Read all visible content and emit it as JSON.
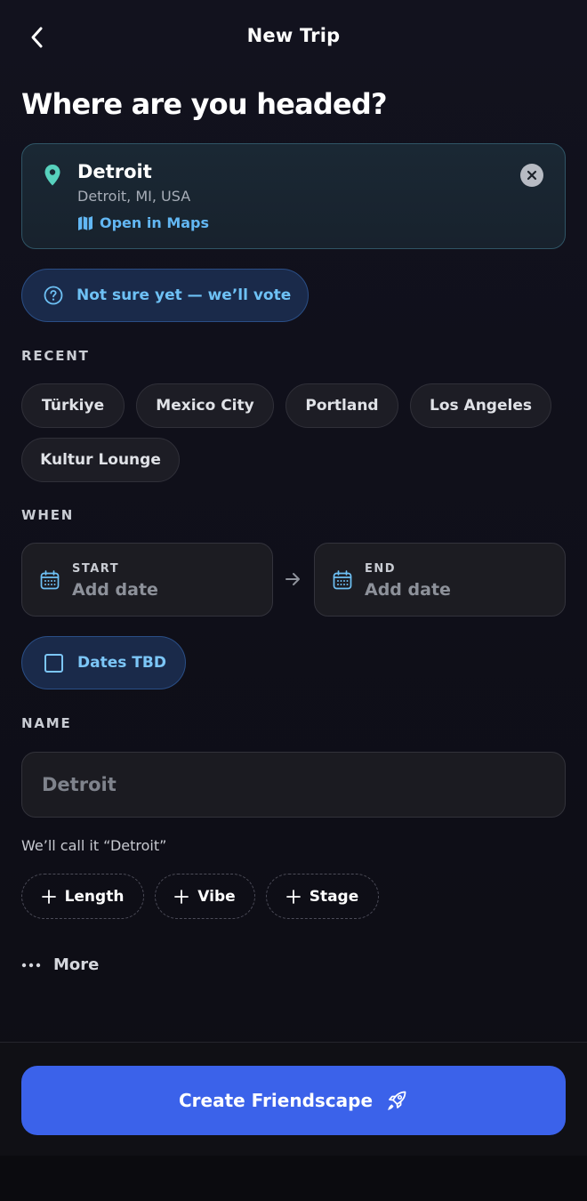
{
  "nav": {
    "title": "New Trip",
    "back_icon": "chevron-left-icon"
  },
  "heading": "Where are you headed?",
  "destination": {
    "name": "Detroit",
    "location": "Detroit, MI, USA",
    "maps_link": "Open in Maps",
    "pin_icon": "map-pin-icon",
    "clear_icon": "close-icon"
  },
  "vote_option": {
    "label": "Not sure yet — we’ll vote",
    "icon": "question-circle-icon"
  },
  "recent": {
    "label": "RECENT",
    "items": [
      "Türkiye",
      "Mexico City",
      "Portland",
      "Los Angeles",
      "Kultur Lounge"
    ]
  },
  "when": {
    "label": "WHEN",
    "start": {
      "label": "START",
      "value": "Add date"
    },
    "end": {
      "label": "END",
      "value": "Add date"
    },
    "tbd": {
      "label": "Dates TBD",
      "checked": false
    }
  },
  "name": {
    "label": "NAME",
    "placeholder": "Detroit",
    "hint": "We’ll call it “Detroit”"
  },
  "tags": [
    {
      "label": "Length"
    },
    {
      "label": "Vibe"
    },
    {
      "label": "Stage"
    }
  ],
  "more": {
    "label": "More"
  },
  "cta": {
    "label": "Create Friendscape",
    "icon": "rocket-icon"
  },
  "colors": {
    "accent": "#3b62ea",
    "link": "#62b7f3",
    "pin": "#57d1bd",
    "background": "#12121e"
  }
}
